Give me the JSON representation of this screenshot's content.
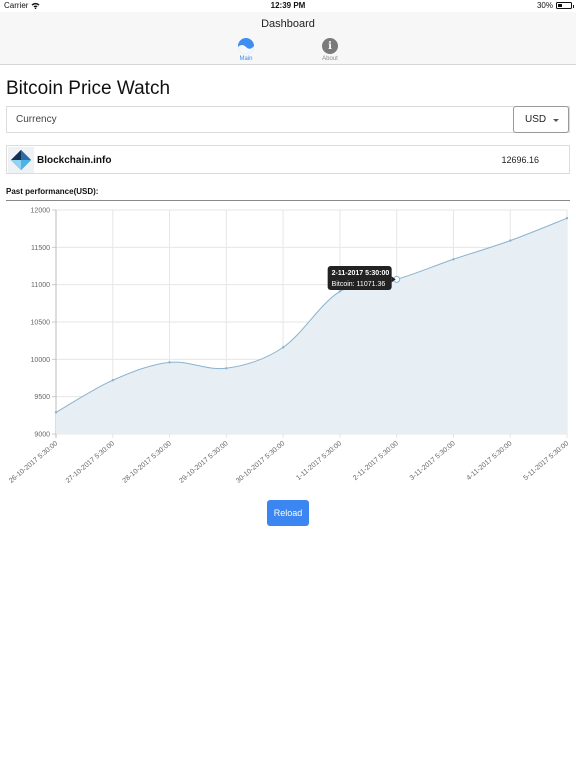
{
  "status_bar": {
    "carrier": "Carrier",
    "time": "12:39 PM",
    "battery": "30%",
    "battery_level": 0.3
  },
  "nav": {
    "title": "Dashboard",
    "tabs": [
      {
        "label": "Main",
        "icon": "wave-icon",
        "active": true
      },
      {
        "label": "About",
        "icon": "info-icon",
        "glyph": "i",
        "active": false
      }
    ]
  },
  "page": {
    "title": "Bitcoin Price Watch"
  },
  "currency": {
    "label": "Currency",
    "selected": "USD"
  },
  "source": {
    "name": "Blockchain.info",
    "price": "12696.16"
  },
  "performance": {
    "title": "Past performance(USD):"
  },
  "tooltip": {
    "title": "2-11-2017 5:30:00",
    "body": "Bitcoin: 11071.36",
    "index": 6
  },
  "reload_label": "Reload",
  "colors": {
    "accent": "#3b86f0",
    "line": "#8ab3cf",
    "fill": "#e8eff4",
    "tooltip_bg": "#222222"
  },
  "chart_data": {
    "type": "area",
    "categories": [
      "26-10-2017 5:30:00",
      "27-10-2017 5:30:00",
      "28-10-2017 5:30:00",
      "29-10-2017 5:30:00",
      "30-10-2017 5:30:00",
      "1-11-2017 5:30:00",
      "2-11-2017 5:30:00",
      "3-11-2017 5:30:00",
      "4-11-2017 5:30:00",
      "5-11-2017 5:30:00"
    ],
    "series": [
      {
        "name": "Bitcoin",
        "values": [
          9290,
          9720,
          9960,
          9880,
          10160,
          10910,
          11071.36,
          11340,
          11590,
          11890
        ]
      }
    ],
    "ylim": [
      9000,
      12000
    ],
    "yticks": [
      12000,
      11500,
      11000,
      10500,
      10000,
      9500,
      9000
    ],
    "grid": true,
    "legend": "none"
  }
}
